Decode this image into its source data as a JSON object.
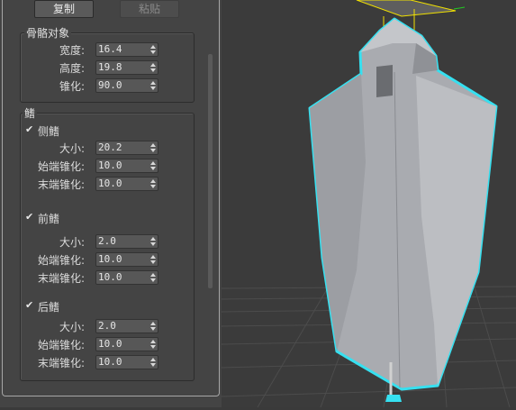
{
  "toolbar": {
    "copy_label": "复制",
    "paste_label": "粘贴"
  },
  "bone_object": {
    "title": "骨骼对象",
    "rows": [
      {
        "label": "宽度:",
        "value": "16.4"
      },
      {
        "label": "高度:",
        "value": "19.8"
      },
      {
        "label": "锥化:",
        "value": "90.0"
      }
    ]
  },
  "fins": {
    "title": "鳍",
    "groups": [
      {
        "check_label": "侧鳍",
        "checked": true,
        "rows": [
          {
            "label": "大小:",
            "value": "20.2"
          },
          {
            "label": "始端锥化:",
            "value": "10.0"
          },
          {
            "label": "末端锥化:",
            "value": "10.0"
          }
        ]
      },
      {
        "check_label": "前鳍",
        "checked": true,
        "rows": [
          {
            "label": "大小:",
            "value": "2.0"
          },
          {
            "label": "始端锥化:",
            "value": "10.0"
          },
          {
            "label": "末端锥化:",
            "value": "10.0"
          }
        ]
      },
      {
        "check_label": "后鳍",
        "checked": true,
        "rows": [
          {
            "label": "大小:",
            "value": "2.0"
          },
          {
            "label": "始端锥化:",
            "value": "10.0"
          },
          {
            "label": "末端锥化:",
            "value": "10.0"
          }
        ]
      }
    ]
  },
  "colors": {
    "selection_outline": "#36e0f0",
    "bone_fill": "#a9abb0",
    "gizmo_yellow": "#f0e000"
  }
}
